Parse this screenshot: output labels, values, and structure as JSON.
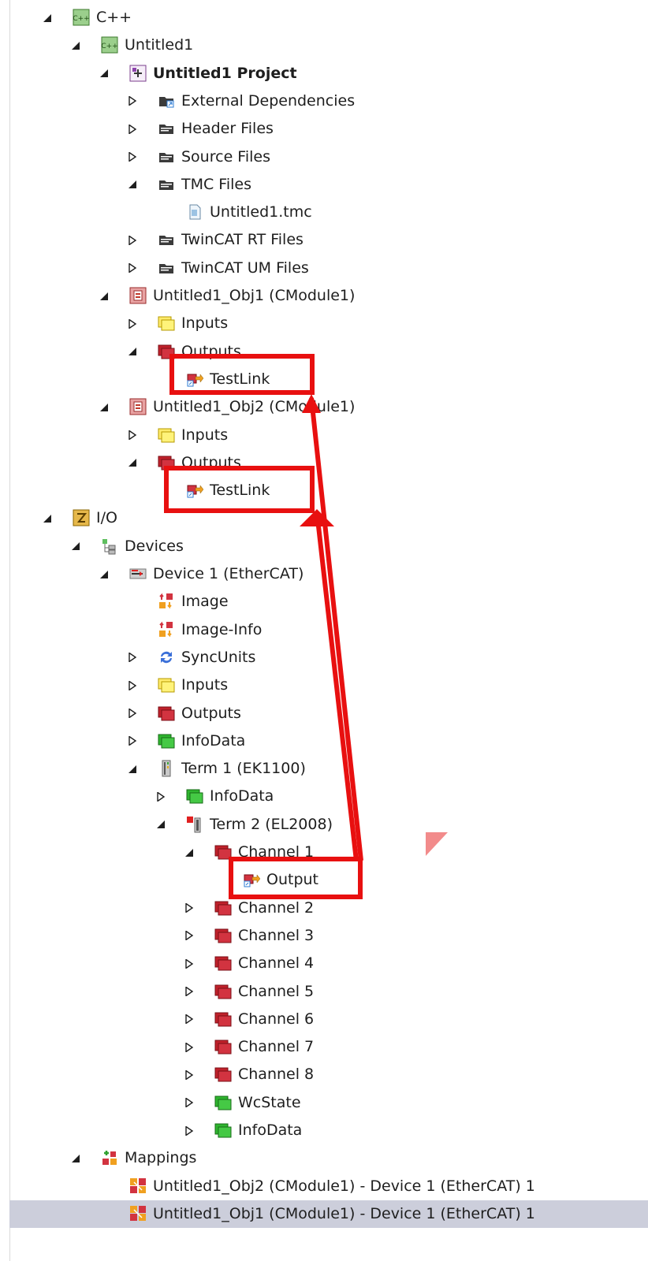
{
  "tree": {
    "rows": [
      {
        "label": "C++",
        "level": 0,
        "expander": "expanded",
        "icon": "cpp-project-icon",
        "bold": false
      },
      {
        "label": "Untitled1",
        "level": 1,
        "expander": "expanded",
        "icon": "cpp-project-icon",
        "bold": false
      },
      {
        "label": "Untitled1 Project",
        "level": 2,
        "expander": "expanded",
        "icon": "vc-project-icon",
        "bold": true
      },
      {
        "label": "External Dependencies",
        "level": 3,
        "expander": "collapsed",
        "icon": "external-deps-folder-icon",
        "bold": false
      },
      {
        "label": "Header Files",
        "level": 3,
        "expander": "collapsed",
        "icon": "filter-folder-icon",
        "bold": false
      },
      {
        "label": "Source Files",
        "level": 3,
        "expander": "collapsed",
        "icon": "filter-folder-icon",
        "bold": false
      },
      {
        "label": "TMC Files",
        "level": 3,
        "expander": "expanded",
        "icon": "filter-folder-icon",
        "bold": false
      },
      {
        "label": "Untitled1.tmc",
        "level": 4,
        "expander": "none",
        "icon": "file-icon",
        "bold": false
      },
      {
        "label": "TwinCAT RT Files",
        "level": 3,
        "expander": "collapsed",
        "icon": "filter-folder-icon",
        "bold": false
      },
      {
        "label": "TwinCAT UM Files",
        "level": 3,
        "expander": "collapsed",
        "icon": "filter-folder-icon",
        "bold": false
      },
      {
        "label": "Untitled1_Obj1 (CModule1)",
        "level": 2,
        "expander": "expanded",
        "icon": "module-instance-icon",
        "bold": false
      },
      {
        "label": "Inputs",
        "level": 3,
        "expander": "collapsed",
        "icon": "inputs-icon",
        "bold": false
      },
      {
        "label": "Outputs",
        "level": 3,
        "expander": "expanded",
        "icon": "outputs-icon",
        "bold": false
      },
      {
        "label": "TestLink",
        "level": 4,
        "expander": "none",
        "icon": "linked-output-var-icon",
        "bold": false
      },
      {
        "label": "Untitled1_Obj2 (CModule1)",
        "level": 2,
        "expander": "expanded",
        "icon": "module-instance-icon",
        "bold": false
      },
      {
        "label": "Inputs",
        "level": 3,
        "expander": "collapsed",
        "icon": "inputs-icon",
        "bold": false
      },
      {
        "label": "Outputs",
        "level": 3,
        "expander": "expanded",
        "icon": "outputs-icon",
        "bold": false
      },
      {
        "label": "TestLink",
        "level": 4,
        "expander": "none",
        "icon": "linked-output-var-icon",
        "bold": false
      },
      {
        "label": "I/O",
        "level": 0,
        "expander": "expanded",
        "icon": "io-icon",
        "bold": false
      },
      {
        "label": "Devices",
        "level": 1,
        "expander": "expanded",
        "icon": "devices-icon",
        "bold": false
      },
      {
        "label": "Device 1 (EtherCAT)",
        "level": 2,
        "expander": "expanded",
        "icon": "ethercat-device-icon",
        "bold": false
      },
      {
        "label": "Image",
        "level": 3,
        "expander": "none",
        "icon": "image-icon",
        "bold": false
      },
      {
        "label": "Image-Info",
        "level": 3,
        "expander": "none",
        "icon": "image-icon",
        "bold": false
      },
      {
        "label": "SyncUnits",
        "level": 3,
        "expander": "collapsed",
        "icon": "sync-units-icon",
        "bold": false
      },
      {
        "label": "Inputs",
        "level": 3,
        "expander": "collapsed",
        "icon": "inputs-icon",
        "bold": false
      },
      {
        "label": "Outputs",
        "level": 3,
        "expander": "collapsed",
        "icon": "outputs-icon",
        "bold": false
      },
      {
        "label": "InfoData",
        "level": 3,
        "expander": "collapsed",
        "icon": "infodata-icon",
        "bold": false
      },
      {
        "label": "Term 1 (EK1100)",
        "level": 3,
        "expander": "expanded",
        "icon": "terminal-coupler-icon",
        "bold": false
      },
      {
        "label": "InfoData",
        "level": 4,
        "expander": "collapsed",
        "icon": "infodata-icon",
        "bold": false
      },
      {
        "label": "Term 2 (EL2008)",
        "level": 4,
        "expander": "expanded",
        "icon": "terminal-output-icon",
        "bold": false
      },
      {
        "label": "Channel 1",
        "level": 5,
        "expander": "expanded",
        "icon": "outputs-icon",
        "bold": false
      },
      {
        "label": "Output",
        "level": 6,
        "expander": "none",
        "icon": "linked-output-var-icon",
        "bold": false
      },
      {
        "label": "Channel 2",
        "level": 5,
        "expander": "collapsed",
        "icon": "outputs-icon",
        "bold": false
      },
      {
        "label": "Channel 3",
        "level": 5,
        "expander": "collapsed",
        "icon": "outputs-icon",
        "bold": false
      },
      {
        "label": "Channel 4",
        "level": 5,
        "expander": "collapsed",
        "icon": "outputs-icon",
        "bold": false
      },
      {
        "label": "Channel 5",
        "level": 5,
        "expander": "collapsed",
        "icon": "outputs-icon",
        "bold": false
      },
      {
        "label": "Channel 6",
        "level": 5,
        "expander": "collapsed",
        "icon": "outputs-icon",
        "bold": false
      },
      {
        "label": "Channel 7",
        "level": 5,
        "expander": "collapsed",
        "icon": "outputs-icon",
        "bold": false
      },
      {
        "label": "Channel 8",
        "level": 5,
        "expander": "collapsed",
        "icon": "outputs-icon",
        "bold": false
      },
      {
        "label": "WcState",
        "level": 5,
        "expander": "collapsed",
        "icon": "infodata-icon",
        "bold": false
      },
      {
        "label": "InfoData",
        "level": 5,
        "expander": "collapsed",
        "icon": "infodata-icon",
        "bold": false
      },
      {
        "label": "Mappings",
        "level": 1,
        "expander": "expanded",
        "icon": "mappings-icon",
        "bold": false
      },
      {
        "label": "Untitled1_Obj2 (CModule1) - Device 1 (EtherCAT) 1",
        "level": 2,
        "expander": "none",
        "icon": "mapping-icon",
        "bold": false
      },
      {
        "label": "Untitled1_Obj1 (CModule1) - Device 1 (EtherCAT) 1",
        "level": 2,
        "expander": "none",
        "icon": "mapping-icon",
        "bold": false,
        "selected": true
      }
    ]
  },
  "annotations": {
    "color": "#e81010",
    "cursor_color": "#f28b8b",
    "highlighted_items": [
      "TestLink",
      "TestLink",
      "Output"
    ]
  },
  "colors": {
    "selected_row": "#cccedb",
    "text": "#1e1e1e",
    "expander": "#1e1e1e"
  }
}
